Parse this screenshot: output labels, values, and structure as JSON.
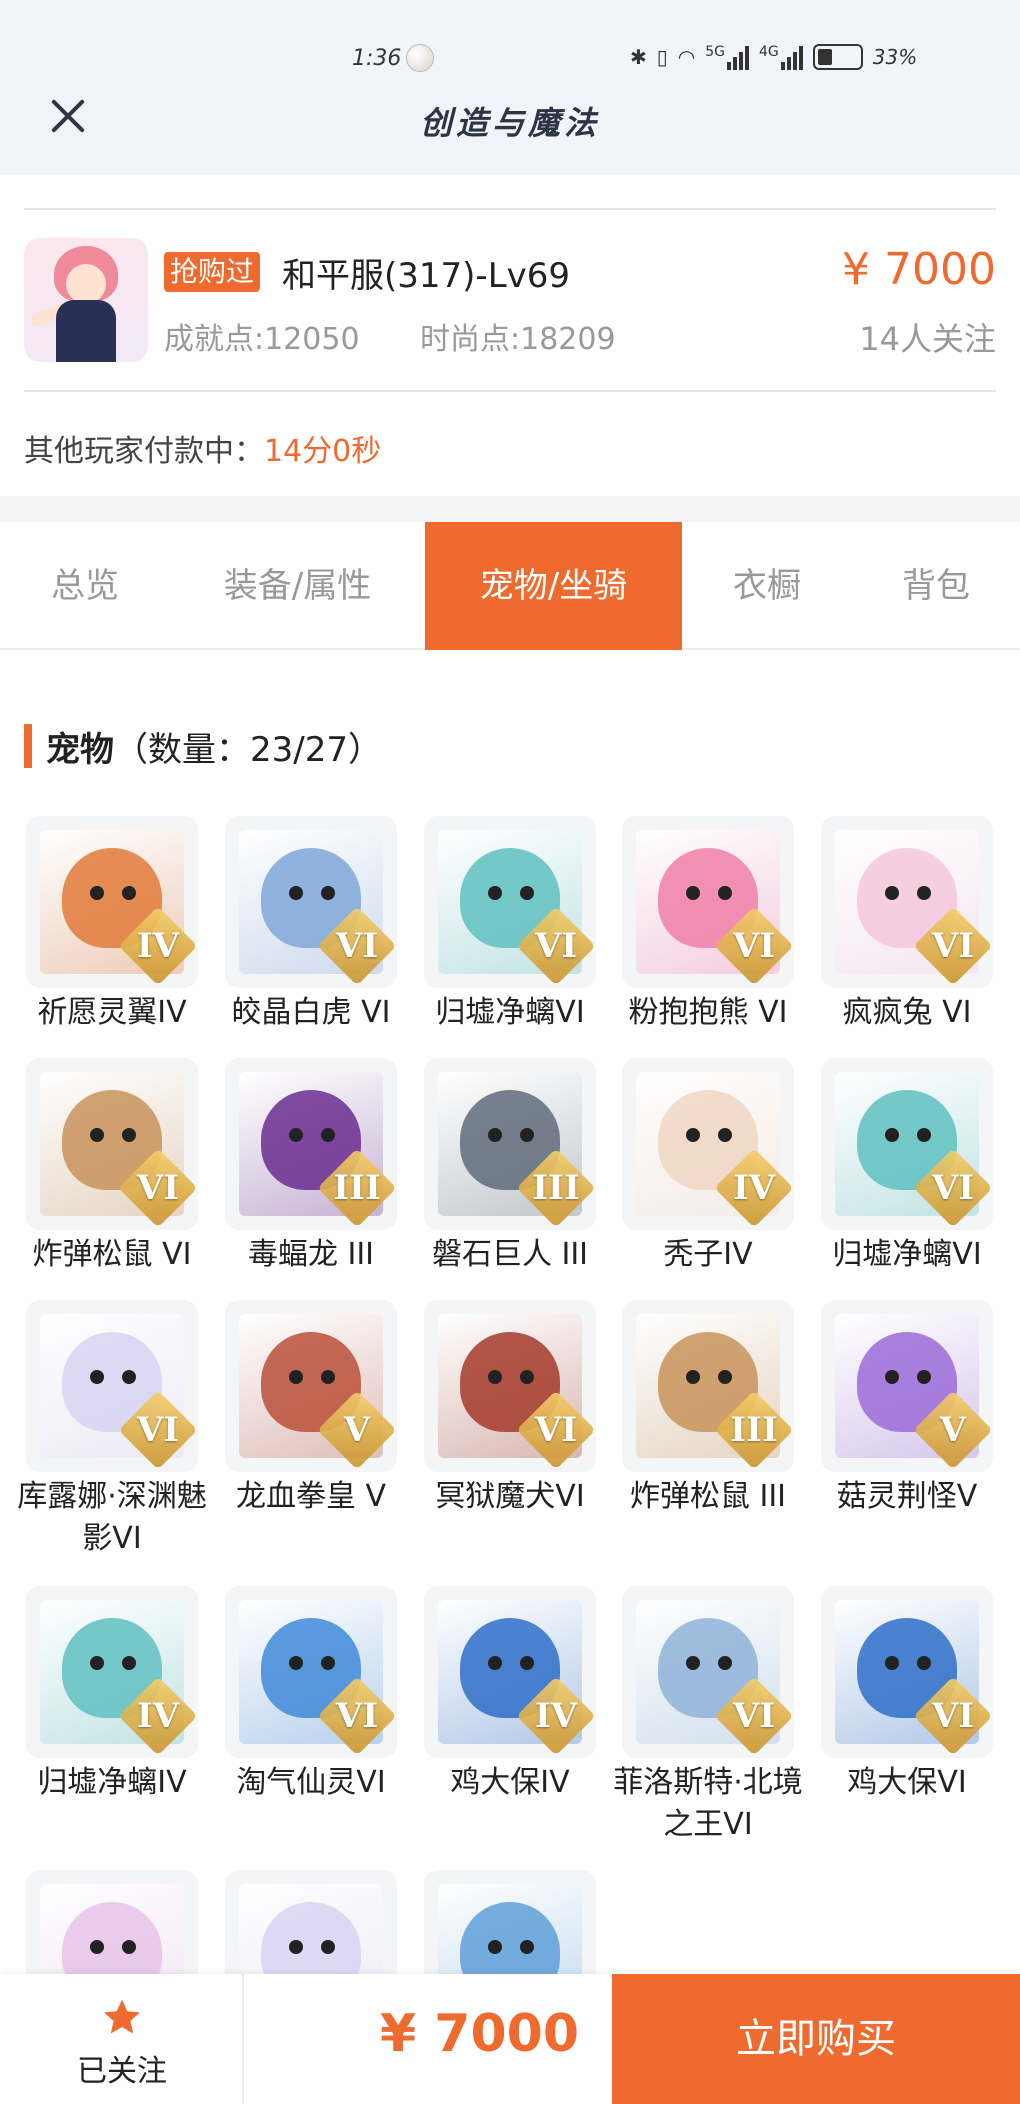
{
  "status_bar": {
    "time": "1:36",
    "network_5g": "5G",
    "network_4g": "4G",
    "battery": "33%"
  },
  "header": {
    "title": "创造与魔法"
  },
  "item": {
    "tag": "抢购过",
    "name": "和平服(317)-Lv69",
    "price": "¥ 7000",
    "achievement": "成就点:12050",
    "fashion": "时尚点:18209",
    "watchers": "14人关注"
  },
  "payment_notice": {
    "text": "其他玩家付款中：",
    "countdown": "14分0秒"
  },
  "tabs": [
    {
      "label": "总览"
    },
    {
      "label": "装备/属性"
    },
    {
      "label": "宠物/坐骑"
    },
    {
      "label": "衣橱"
    },
    {
      "label": "背包"
    }
  ],
  "section": {
    "title": "宠物",
    "count": "（数量：23/27）"
  },
  "pets": [
    {
      "name": "祈愿灵翼IV",
      "rank": "IV",
      "color": "#e07a3a"
    },
    {
      "name": "皎晶白虎 VI",
      "rank": "VI",
      "color": "#7fa6d8"
    },
    {
      "name": "归墟净螭VI",
      "rank": "VI",
      "color": "#5fbfbf"
    },
    {
      "name": "粉抱抱熊 VI",
      "rank": "VI",
      "color": "#f07fa8"
    },
    {
      "name": "疯疯兔 VI",
      "rank": "VI",
      "color": "#f3c8dc"
    },
    {
      "name": "炸弹松鼠 VI",
      "rank": "VI",
      "color": "#c8935a"
    },
    {
      "name": "毒蝠龙 III",
      "rank": "III",
      "color": "#6b2d8f"
    },
    {
      "name": "磐石巨人 III",
      "rank": "III",
      "color": "#5f6b7a"
    },
    {
      "name": "秃子IV",
      "rank": "IV",
      "color": "#f0d6c2"
    },
    {
      "name": "归墟净螭VI",
      "rank": "VI",
      "color": "#5fbfbf"
    },
    {
      "name": "库露娜·深渊魅影VI",
      "rank": "VI",
      "color": "#d8d4f2"
    },
    {
      "name": "龙血拳皇 V",
      "rank": "V",
      "color": "#b8503a"
    },
    {
      "name": "冥狱魔犬VI",
      "rank": "VI",
      "color": "#a33a2a"
    },
    {
      "name": "炸弹松鼠 III",
      "rank": "III",
      "color": "#c8935a"
    },
    {
      "name": "菇灵荆怪V",
      "rank": "V",
      "color": "#9b6bd8"
    },
    {
      "name": "归墟净螭IV",
      "rank": "IV",
      "color": "#5fbfbf"
    },
    {
      "name": "淘气仙灵VI",
      "rank": "VI",
      "color": "#3f8ad8"
    },
    {
      "name": "鸡大保IV",
      "rank": "IV",
      "color": "#2f6fc8"
    },
    {
      "name": "菲洛斯特·北境之王VI",
      "rank": "VI",
      "color": "#8fb3d8"
    },
    {
      "name": "鸡大保VI",
      "rank": "VI",
      "color": "#2f6fc8"
    },
    {
      "name": "",
      "rank": "",
      "color": "#e8c3e8"
    },
    {
      "name": "",
      "rank": "",
      "color": "#d8d4f2"
    },
    {
      "name": "",
      "rank": "",
      "color": "#5f9fd8"
    }
  ],
  "bottom_bar": {
    "follow_label": "已关注",
    "price": "¥ 7000",
    "buy_label": "立即购买"
  },
  "colors": {
    "accent": "#ee6a2e",
    "header_bg": "#f1f4f8",
    "title": "#2c3445"
  }
}
